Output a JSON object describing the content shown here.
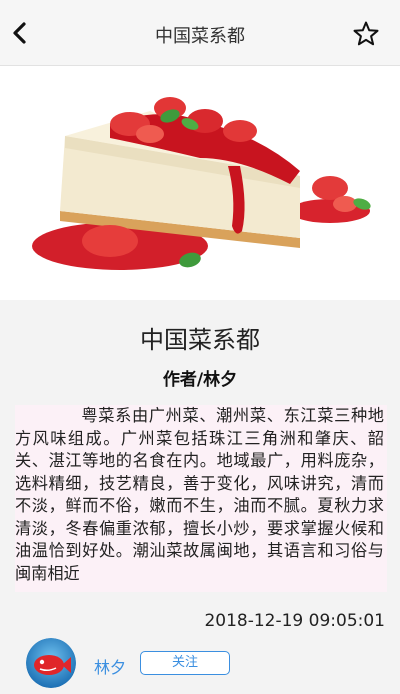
{
  "navbar": {
    "title": "中国菜系都",
    "back_icon": "chevron-left-icon",
    "favorite_icon": "star-outline-icon"
  },
  "hero": {
    "description": "strawberry-cheesecake-image"
  },
  "article": {
    "title": "中国菜系都",
    "author_line": "作者/林夕",
    "content": "粤菜系由广州菜、潮州菜、东江菜三种地方风味组成。广州菜包括珠江三角洲和肇庆、韶关、湛江等地的名食在内。地域最广，用料庞杂，选料精细，技艺精良，善于变化，风味讲究，清而不淡，鲜而不俗，嫩而不生，油而不腻。夏秋力求清淡，冬春偏重浓郁，擅长小炒，要求掌握火候和油温恰到好处。潮汕菜故属闽地，其语言和习俗与闽南相近",
    "time": "2018-12-19 09:05:01"
  },
  "author": {
    "name": "林夕",
    "follow_label": "关注",
    "avatar_icon": "red-fish-avatar"
  },
  "colors": {
    "accent": "#3b8fe0",
    "content_bg": "#fcf1f7",
    "page_bg": "#f3f3f3"
  }
}
